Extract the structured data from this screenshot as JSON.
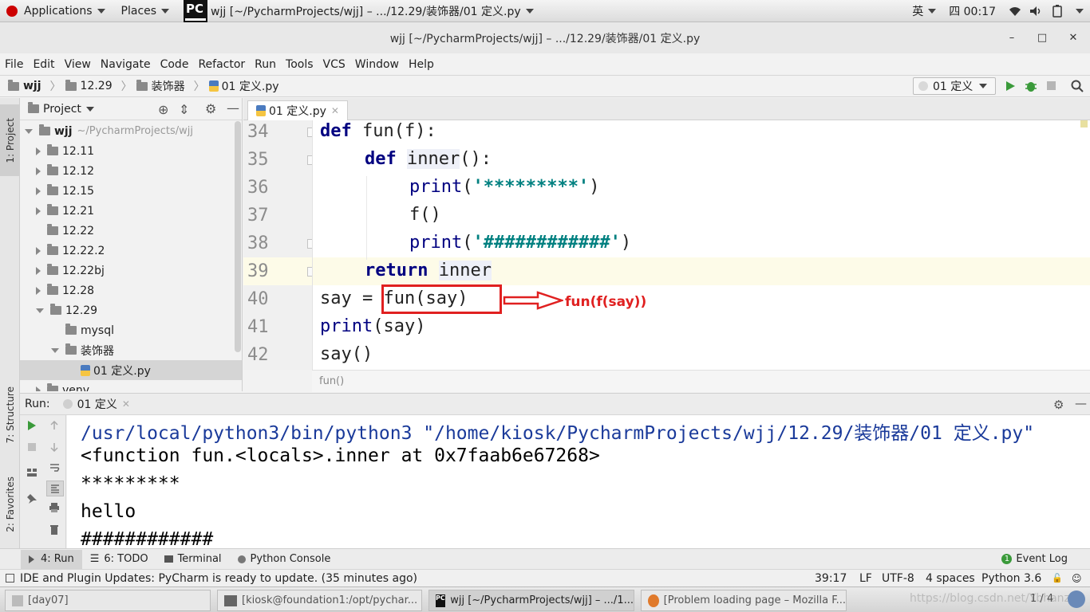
{
  "gnome_bar": {
    "applications": "Applications",
    "places": "Places",
    "window_label": "wjj [~/PycharmProjects/wjj] – .../12.29/装饰器/01 定义.py",
    "input_method": "英",
    "clock": "四 00:17"
  },
  "window": {
    "title": "wjj [~/PycharmProjects/wjj] – .../12.29/装饰器/01 定义.py",
    "minimize": "–",
    "maximize": "□",
    "close": "✕"
  },
  "menu": [
    "File",
    "Edit",
    "View",
    "Navigate",
    "Code",
    "Refactor",
    "Run",
    "Tools",
    "VCS",
    "Window",
    "Help"
  ],
  "navbar": {
    "crumbs": [
      "wjj",
      "12.29",
      "装饰器",
      "01 定义.py"
    ],
    "run_config": "01 定义"
  },
  "left_strip": {
    "project_tab": "1: Project",
    "structure_tab": "7: Structure",
    "favorites_tab": "2: Favorites"
  },
  "project": {
    "header": "Project",
    "root_name": "wjj",
    "root_path": "~/PycharmProjects/wjj",
    "items": [
      {
        "label": "12.11"
      },
      {
        "label": "12.12"
      },
      {
        "label": "12.15"
      },
      {
        "label": "12.21"
      },
      {
        "label": "12.22"
      },
      {
        "label": "12.22.2"
      },
      {
        "label": "12.22bj"
      },
      {
        "label": "12.28"
      },
      {
        "label": "12.29"
      },
      {
        "label": "mysql"
      },
      {
        "label": "装饰器"
      },
      {
        "label": "01 定义.py"
      },
      {
        "label": "venv"
      }
    ]
  },
  "editor": {
    "tab_label": "01 定义.py",
    "line_numbers": [
      "34",
      "35",
      "36",
      "37",
      "38",
      "39",
      "40",
      "41",
      "42"
    ],
    "code": {
      "l34_kw": "def",
      "l34_rest": " fun(f):",
      "l35_kw": "def",
      "l35_name": "inner",
      "l35_rest": "():",
      "l36_fn": "print",
      "l36_open": "(",
      "l36_str": "'*********'",
      "l36_close": ")",
      "l37": "f()",
      "l38_fn": "print",
      "l38_open": "(",
      "l38_str": "'############'",
      "l38_close": ")",
      "l39_kw": "return",
      "l39_name": "inner",
      "l40_pre": "say = ",
      "l40_call": "fun(say)",
      "l41_fn": "print",
      "l41_rest": "(say)",
      "l42": "say()"
    },
    "annotation": "fun(f(say))",
    "breadcrumb_fn": "fun()"
  },
  "run_panel": {
    "label": "Run:",
    "tab": "01 定义",
    "console": [
      "/usr/local/python3/bin/python3 \"/home/kiosk/PycharmProjects/wjj/12.29/装饰器/01 定义.py\"",
      "<function fun.<locals>.inner at 0x7faab6e67268>",
      "*********",
      "hello",
      "############"
    ]
  },
  "tool_tabs": {
    "run": "4: Run",
    "todo": "6: TODO",
    "terminal": "Terminal",
    "python_console": "Python Console",
    "event_log": "Event Log",
    "event_count": "1"
  },
  "status": {
    "message": "IDE and Plugin Updates: PyCharm is ready to update. (35 minutes ago)",
    "position": "39:17",
    "line_sep": "LF",
    "encoding": "UTF-8",
    "indent": "4 spaces",
    "interpreter": "Python 3.6"
  },
  "taskbar": {
    "tasks": [
      "[day07]",
      "[kiosk@foundation1:/opt/pychar...",
      "wjj [~/PycharmProjects/wjj] – .../1...",
      "[Problem loading page – Mozilla F..."
    ],
    "watermark": "https://blog.csdn.net/Ybhanzi",
    "workspace": "1 / 4"
  },
  "colors": {
    "keyword": "#000080",
    "string": "#008080",
    "annotation_red": "#e02020"
  }
}
